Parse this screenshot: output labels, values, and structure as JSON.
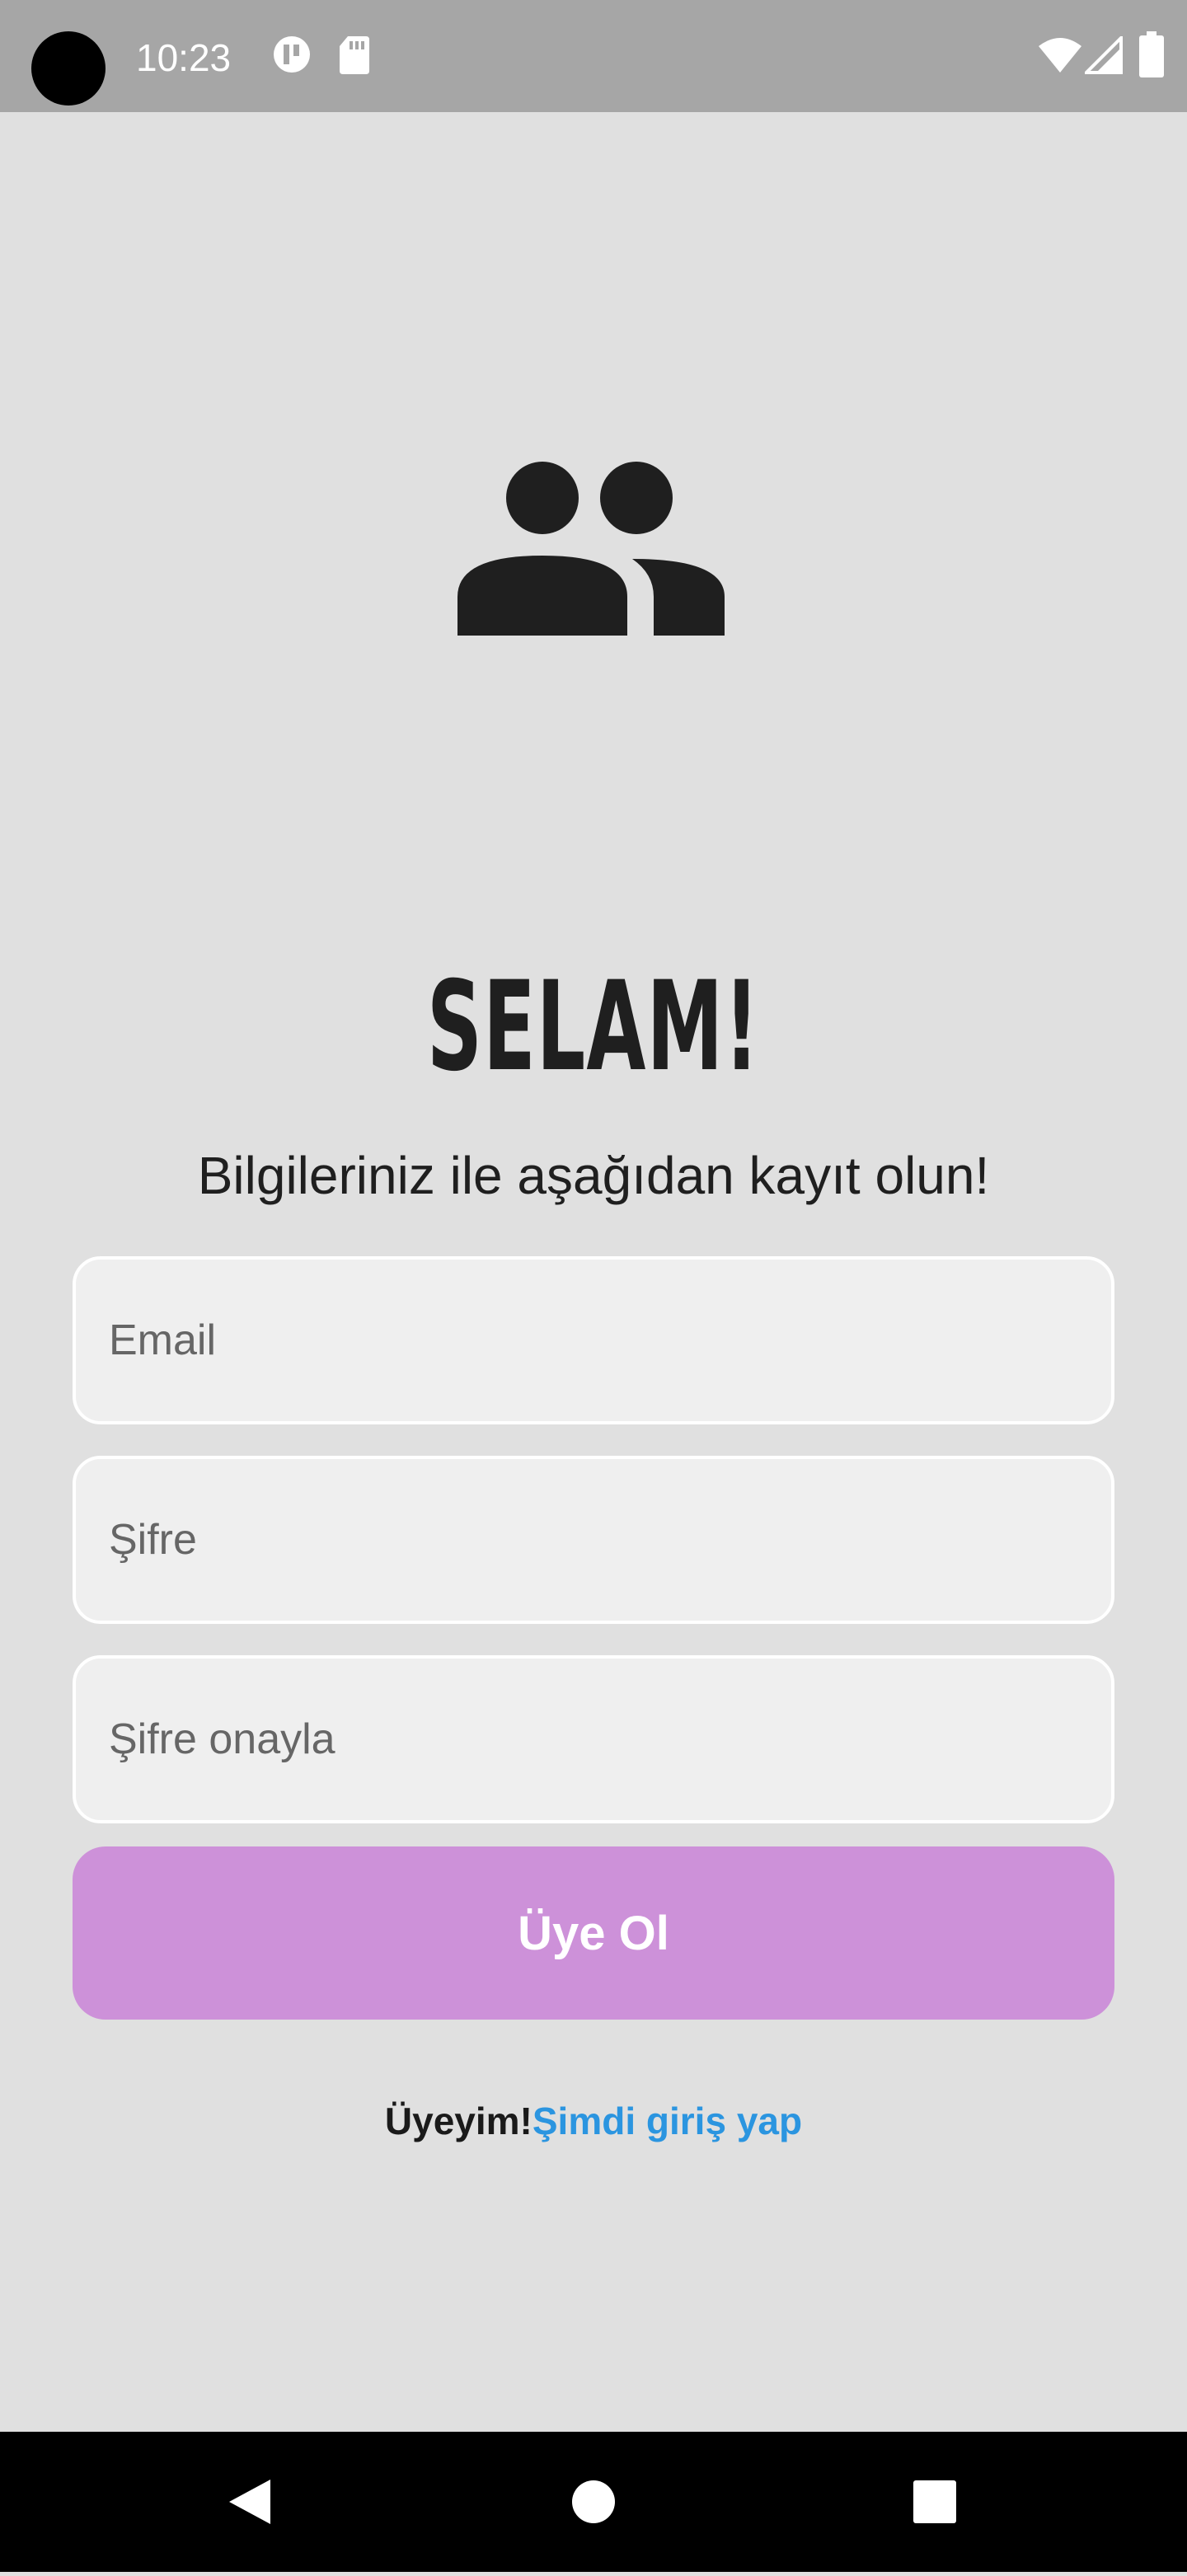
{
  "status_bar": {
    "time": "10:23",
    "icons": [
      "camera-cutout",
      "privacy-icon",
      "sd-card-icon",
      "wifi-icon",
      "signal-icon",
      "battery-icon"
    ]
  },
  "header": {
    "icon": "group-icon",
    "title": "SELAM!",
    "subtitle": "Bilgileriniz ile aşağıdan kayıt olun!"
  },
  "form": {
    "email": {
      "placeholder": "Email",
      "value": ""
    },
    "password": {
      "placeholder": "Şifre",
      "value": ""
    },
    "password_confirm": {
      "placeholder": "Şifre onayla",
      "value": ""
    },
    "submit_label": "Üye Ol"
  },
  "login": {
    "prompt": "Üyeyim!",
    "link": "Şimdi giriş yap"
  },
  "nav_bar": {
    "icons": [
      "back-icon",
      "home-icon",
      "recents-icon"
    ]
  },
  "colors": {
    "background": "#e0e0e0",
    "status_bar": "#a6a6a6",
    "button": "#cd91d9",
    "link": "#2b95e0",
    "field_bg": "#efefef"
  }
}
